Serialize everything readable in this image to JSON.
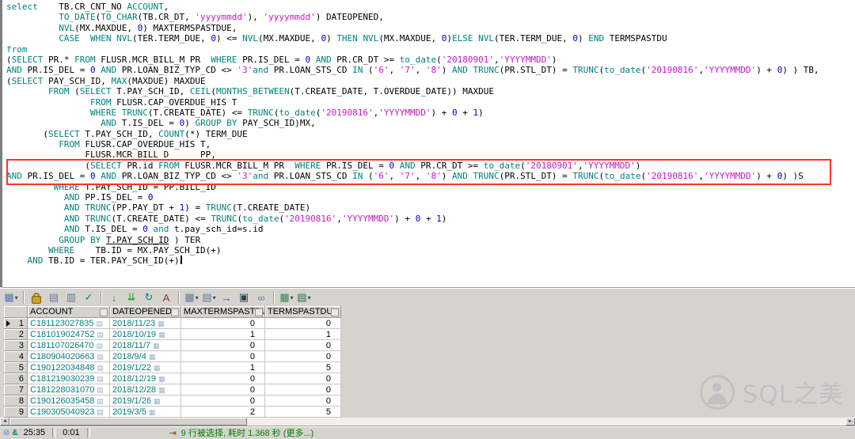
{
  "colors": {
    "kw": "#008080",
    "str": "#c617c6",
    "num": "#0000c8",
    "box": "#ff3226",
    "cell": "#067d7d",
    "msg": "#008000"
  },
  "editor": {
    "keywords": [
      "SELECT",
      "FROM",
      "WHERE",
      "AND",
      "OR",
      "IN",
      "IS",
      "NOT",
      "NULL",
      "CASE",
      "WHEN",
      "THEN",
      "ELSE",
      "END",
      "GROUP",
      "BY",
      "ACCOUNT",
      "TO_DATE",
      "TO_CHAR",
      "NVL",
      "MAX",
      "CEIL",
      "MONTHS_BETWEEN",
      "COUNT",
      "TRUNC"
    ],
    "lines": [
      "select    TB.CR_CNT_NO ACCOUNT,",
      "          TO_DATE(TO_CHAR(TB.CR_DT, 'yyyymmdd'), 'yyyymmdd') DATEOPENED,",
      "          NVL(MX.MAXDUE, 0) MAXTERMSPASTDUE,",
      "          CASE  WHEN NVL(TER.TERM_DUE, 0) <= NVL(MX.MAXDUE, 0) THEN NVL(MX.MAXDUE, 0)ELSE NVL(TER.TERM_DUE, 0) END TERMSPASTDU",
      "from",
      "(SELECT PR.* FROM FLUSR.MCR_BILL_M PR  WHERE PR.IS_DEL = 0 AND PR.CR_DT >= to_date('20180901','YYYYMMDD')",
      "AND PR.IS_DEL = 0 AND PR.LOAN_BIZ_TYP_CD <> '3'and PR.LOAN_STS_CD IN ('6', '7', '8') AND TRUNC(PR.STL_DT) = TRUNC(to_date('20190816','YYYYMMDD') + 0) ) TB,",
      "(SELECT PAY_SCH_ID, MAX(MAXDUE) MAXDUE",
      "        FROM (SELECT T.PAY_SCH_ID, CEIL(MONTHS_BETWEEN(T.CREATE_DATE, T.OVERDUE_DATE)) MAXDUE",
      "                FROM FLUSR.CAP_OVERDUE_HIS T",
      "                WHERE TRUNC(T.CREATE_DATE) <= TRUNC(to_date('20190816','YYYYMMDD') + 0 + 1)",
      "                  AND T.IS_DEL = 0) GROUP BY PAY_SCH_ID)MX,",
      "       (SELECT T.PAY_SCH_ID, COUNT(*) TERM_DUE",
      "          FROM FLUSR.CAP_OVERDUE_HIS T,",
      "               FLUSR.MCR_BILL_D      PP,",
      "               (SELECT PR.id FROM FLUSR.MCR_BILL_M PR  WHERE PR.IS_DEL = 0 AND PR.CR_DT >= to_date('20180901','YYYYMMDD')",
      "AND PR.IS_DEL = 0 AND PR.LOAN_BIZ_TYP_CD <> '3'and PR.LOAN_STS_CD IN ('6', '7', '8') AND TRUNC(PR.STL_DT) = TRUNC(to_date('20190816','YYYYMMDD') + 0) )S",
      "         WHERE T.PAY_SCH_ID = PP.BILL_ID",
      "           AND PP.IS_DEL = 0",
      "           AND TRUNC(PP.PAY_DT + 1) = TRUNC(T.CREATE_DATE)",
      "           AND TRUNC(T.CREATE_DATE) <= TRUNC(to_date('20190816','YYYYMMDD') + 0 + 1)",
      "           AND T.IS_DEL = 0 and t.pay_sch_id=s.id",
      "          GROUP BY T.PAY_SCH_ID ) TER",
      "        WHERE    TB.ID = MX.PAY_SCH_ID(+)",
      "    AND TB.ID = TER.PAY_SCH_ID(+)"
    ],
    "underline": {
      "line": 23,
      "text": "T.PAY_SCH_ID"
    },
    "cursor_line": 25
  },
  "toolbar": {
    "icons": [
      {
        "name": "window-selector-icon",
        "glyph": "▦",
        "color": "#4f74b3",
        "dropdown": true
      },
      {
        "sep": true
      },
      {
        "name": "lock-icon",
        "css": "lock"
      },
      {
        "name": "export-query-icon",
        "glyph": "▤",
        "color": "#607d9c"
      },
      {
        "name": "edit-data-icon",
        "glyph": "▥",
        "color": "#607d9c"
      },
      {
        "name": "post-changes-icon",
        "glyph": "✓",
        "color": "#008080"
      },
      {
        "sep": true
      },
      {
        "name": "fetch-next-page-icon",
        "glyph": "↓",
        "color": "#1e9e1e"
      },
      {
        "name": "fetch-all-icon",
        "glyph": "⇊",
        "color": "#1e9e1e"
      },
      {
        "name": "refresh-icon",
        "glyph": "↻",
        "color": "#008080"
      },
      {
        "name": "find-record-icon",
        "glyph": "A",
        "color": "#8b3a3a"
      },
      {
        "sep": true
      },
      {
        "name": "grid-options-icon",
        "glyph": "▦",
        "color": "#607d9c",
        "dropdown": true
      },
      {
        "name": "export-grid-icon",
        "glyph": "▤",
        "color": "#607d9c",
        "dropdown": true
      },
      {
        "name": "next-set-icon",
        "glyph": "→",
        "color": "#2a52be"
      },
      {
        "name": "save-results-icon",
        "glyph": "▣",
        "color": "#36454f"
      },
      {
        "name": "linked-query-icon",
        "glyph": "∞",
        "color": "#607d9c"
      },
      {
        "sep": true
      },
      {
        "name": "report-icon",
        "glyph": "▦",
        "color": "#2e8b57",
        "dropdown": true
      },
      {
        "name": "export-excel-icon",
        "glyph": "▤",
        "color": "#1d6f42",
        "dropdown": true
      }
    ]
  },
  "grid": {
    "columns": [
      "ACCOUNT",
      "DATEOPENED",
      "MAXTERMSPASTDUE",
      "TERMSPASTDU"
    ],
    "rows": [
      {
        "num": "1",
        "account": "C181123027835",
        "dateopened": "2018/11/23",
        "maxtermspastdue": "0",
        "termspastdu": "0"
      },
      {
        "num": "2",
        "account": "C181019024752",
        "dateopened": "2018/10/19",
        "maxtermspastdue": "1",
        "termspastdu": "1"
      },
      {
        "num": "3",
        "account": "C181107026470",
        "dateopened": "2018/11/7",
        "maxtermspastdue": "0",
        "termspastdu": "0"
      },
      {
        "num": "4",
        "account": "C180904020663",
        "dateopened": "2018/9/4",
        "maxtermspastdue": "0",
        "termspastdu": "0"
      },
      {
        "num": "5",
        "account": "C190122034848",
        "dateopened": "2019/1/22",
        "maxtermspastdue": "1",
        "termspastdu": "5"
      },
      {
        "num": "6",
        "account": "C181219030239",
        "dateopened": "2018/12/19",
        "maxtermspastdue": "0",
        "termspastdu": "0"
      },
      {
        "num": "7",
        "account": "C181228031070",
        "dateopened": "2018/12/28",
        "maxtermspastdue": "0",
        "termspastdu": "0"
      },
      {
        "num": "8",
        "account": "C190126035458",
        "dateopened": "2019/1/26",
        "maxtermspastdue": "0",
        "termspastdu": "0"
      },
      {
        "num": "9",
        "account": "C190305040923",
        "dateopened": "2019/3/5",
        "maxtermspastdue": "2",
        "termspastdu": "5"
      }
    ]
  },
  "statusbar": {
    "cursor_position": "25:35",
    "elapsed": "0:01",
    "message": "9 行被选择, 耗时 1.368 秒 (更多...)"
  },
  "watermark": {
    "text": "SQL之美"
  }
}
